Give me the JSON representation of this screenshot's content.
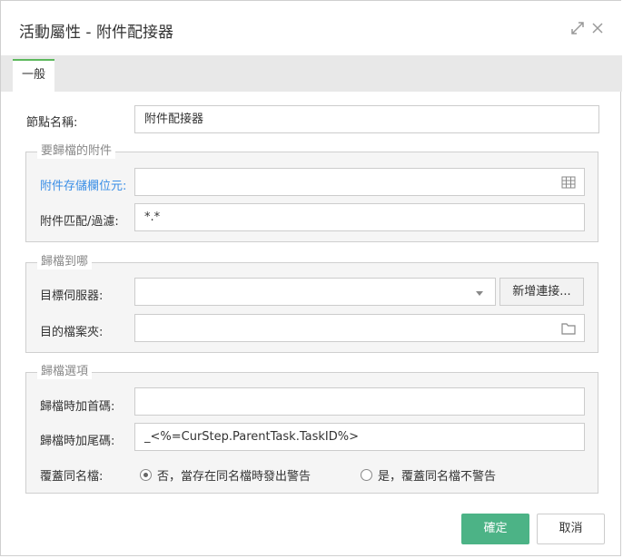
{
  "dialog": {
    "title": "活動屬性 - 附件配接器"
  },
  "tabs": [
    {
      "label": "一般",
      "active": true
    }
  ],
  "node_name": {
    "label": "節點名稱:",
    "value": "附件配接器"
  },
  "attachments_group": {
    "legend": "要歸檔的附件",
    "storage_field": {
      "label": "附件存儲欄位元:",
      "value": "",
      "icon": "table-icon"
    },
    "match_filter": {
      "label": "附件匹配/過濾:",
      "value": "*.*"
    }
  },
  "archive_to_group": {
    "legend": "歸檔到哪",
    "target_server": {
      "label": "目標伺服器:",
      "value": "",
      "new_button": "新增連接..."
    },
    "target_folder": {
      "label": "目的檔案夾:",
      "value": "",
      "icon": "folder-icon"
    }
  },
  "options_group": {
    "legend": "歸檔選項",
    "prefix": {
      "label": "歸檔時加首碼:",
      "value": ""
    },
    "suffix": {
      "label": "歸檔時加尾碼:",
      "value": "_<%=CurStep.ParentTask.TaskID%>"
    },
    "overwrite": {
      "label": "覆蓋同名檔:",
      "options": [
        {
          "label": "否，當存在同名檔時發出警告",
          "selected": true
        },
        {
          "label": "是，覆蓋同名檔不警告",
          "selected": false
        }
      ]
    }
  },
  "footer": {
    "ok_label": "確定",
    "cancel_label": "取消"
  },
  "colors": {
    "accent": "#4cb386",
    "link": "#3a8ee6",
    "tab_indicator": "#5cb85c"
  }
}
